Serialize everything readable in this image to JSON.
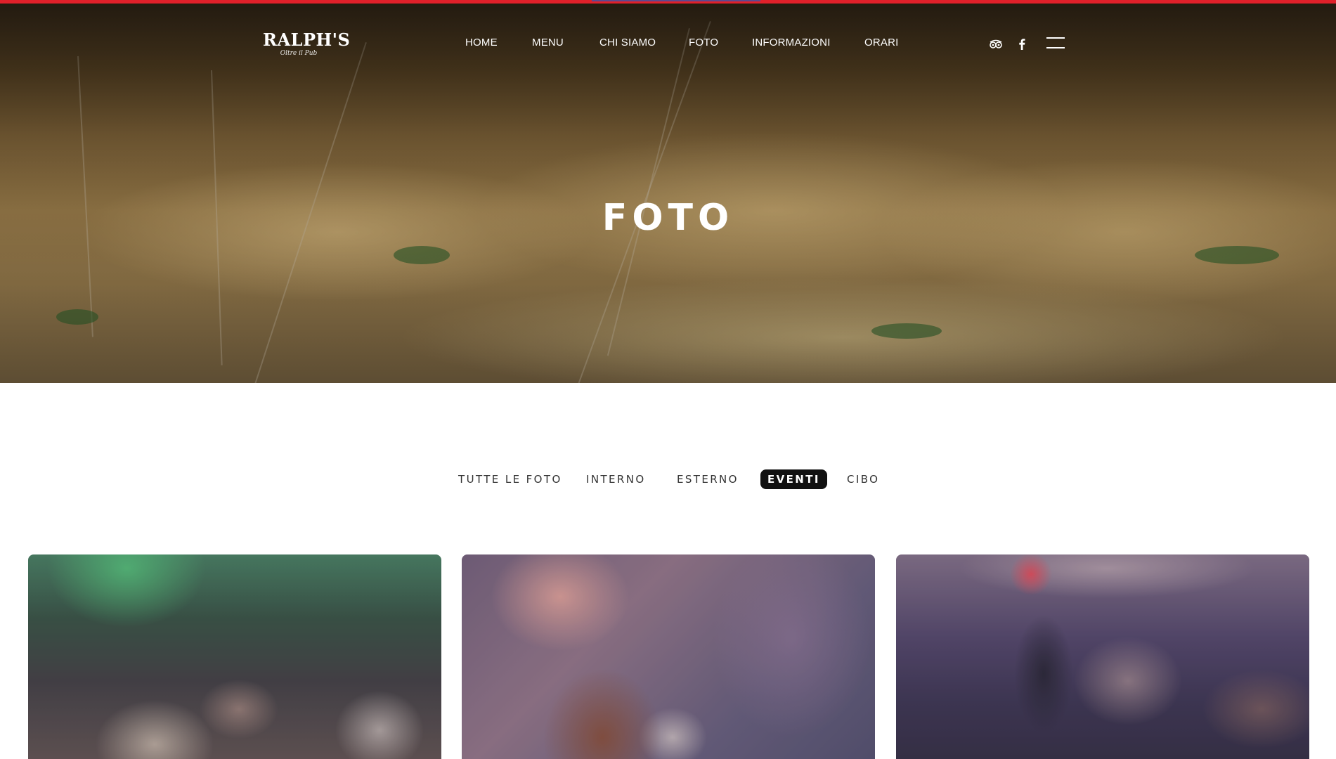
{
  "header": {
    "logo": {
      "name": "RALPH'S",
      "tagline": "Oltre il Pub"
    },
    "nav": [
      {
        "label": "HOME"
      },
      {
        "label": "MENU"
      },
      {
        "label": "CHI SIAMO"
      },
      {
        "label": "FOTO"
      },
      {
        "label": "INFORMAZIONI"
      },
      {
        "label": "ORARI"
      }
    ],
    "social": [
      {
        "icon": "tripadvisor-icon"
      },
      {
        "icon": "facebook-icon"
      }
    ],
    "menu_icon": "hamburger-menu-icon"
  },
  "hero": {
    "title": "FOTO"
  },
  "filters": {
    "items": [
      {
        "label": "TUTTE LE FOTO"
      },
      {
        "label": "INTERNO"
      },
      {
        "label": "ESTERNO"
      },
      {
        "label": "EVENTI"
      },
      {
        "label": "CIBO"
      }
    ],
    "active": "EVENTI"
  },
  "gallery": {
    "photos": [
      {
        "subject": "crowd-dancing-photo"
      },
      {
        "subject": "whiskey-pour-photo"
      },
      {
        "subject": "dj-set-photo"
      }
    ]
  },
  "colors": {
    "accent_red": "#e0202a",
    "active_filter_bg": "#111111",
    "text_dark": "#333333"
  }
}
